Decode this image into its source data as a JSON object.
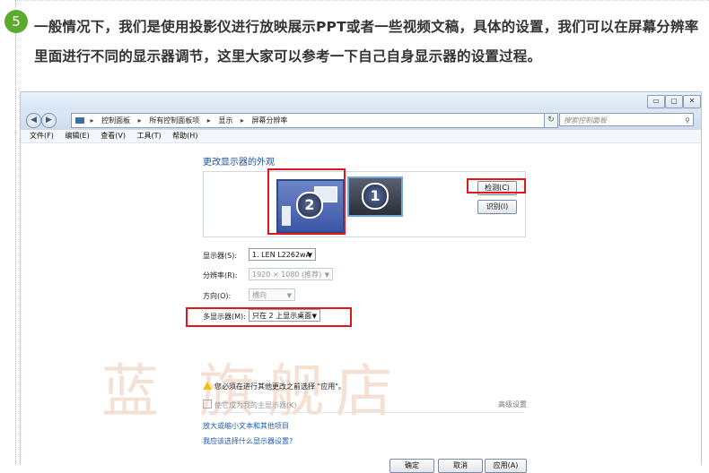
{
  "step": {
    "number": "5"
  },
  "intro_text": "一般情况下，我们是使用投影仪进行放映展示PPT或者一些视频文稿，具体的设置，我们可以在屏幕分辨率里面进行不同的显示器调节，这里大家可以参考一下自己自身显示器的设置过程。",
  "window": {
    "controls": {
      "minimize": "▭",
      "maximize": "▢",
      "close": "✕"
    },
    "address": {
      "segments": [
        "控制面板",
        "所有控制面板项",
        "显示",
        "屏幕分辨率"
      ],
      "separator": "▸"
    },
    "search": {
      "placeholder": "搜索控制面板"
    },
    "menu": [
      "文件(F)",
      "编辑(E)",
      "查看(V)",
      "工具(T)",
      "帮助(H)"
    ]
  },
  "display": {
    "heading": "更改显示器的外观",
    "monitors": [
      {
        "number": "2"
      },
      {
        "number": "1"
      }
    ],
    "detect_button": "检测(C)",
    "identify_button": "识别(I)",
    "fields": {
      "monitor_label": "显示器(S):",
      "monitor_value": "1. LEN L2262wA",
      "resolution_label": "分辨率(R):",
      "resolution_value": "1920 × 1080 (推荐)",
      "orientation_label": "方向(O):",
      "orientation_value": "横向",
      "multi_label": "多显示器(M):",
      "multi_value": "只在 2 上显示桌面"
    },
    "warning": "您必须在进行其他更改之前选择 \"应用\"。",
    "primary_checkbox": "使它成为我的主显示器(K)",
    "advanced_link": "高级设置",
    "links": [
      "放大或缩小文本和其他项目",
      "我应该选择什么显示器设置?"
    ],
    "buttons": {
      "ok": "确定",
      "cancel": "取消",
      "apply": "应用(A)"
    }
  },
  "watermark": "蓝  旗舰店",
  "colors": {
    "highlight": "#e0161f",
    "badge": "#5caa2e",
    "link": "#1e5cb3"
  }
}
